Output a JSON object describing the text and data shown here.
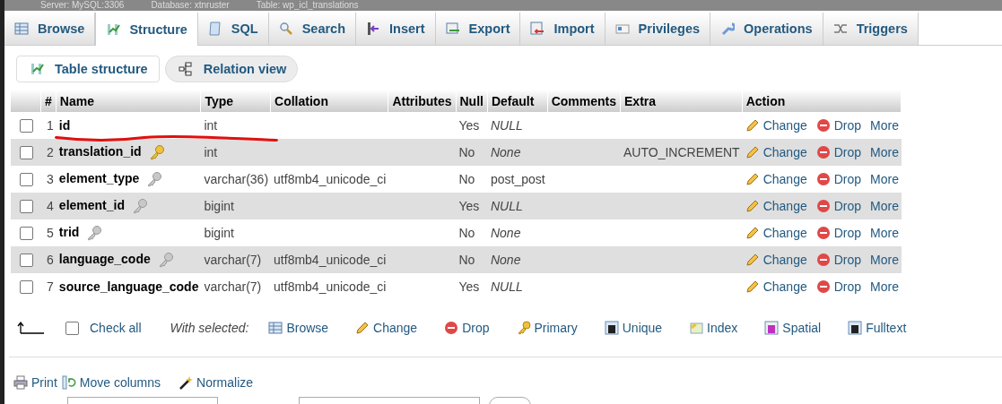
{
  "breadcrumb": [
    "Server: MySQL:3306",
    "Database: xtnruster",
    "Table: wp_icl_translations"
  ],
  "tabs": [
    {
      "label": "Browse",
      "selected": false
    },
    {
      "label": "Structure",
      "selected": true
    },
    {
      "label": "SQL",
      "selected": false
    },
    {
      "label": "Search",
      "selected": false
    },
    {
      "label": "Insert",
      "selected": false
    },
    {
      "label": "Export",
      "selected": false
    },
    {
      "label": "Import",
      "selected": false
    },
    {
      "label": "Privileges",
      "selected": false
    },
    {
      "label": "Operations",
      "selected": false
    },
    {
      "label": "Triggers",
      "selected": false
    }
  ],
  "subtabs": [
    {
      "label": "Table structure",
      "selected": true
    },
    {
      "label": "Relation view",
      "selected": false
    }
  ],
  "table": {
    "columns": [
      "#",
      "Name",
      "Type",
      "Collation",
      "Attributes",
      "Null",
      "Default",
      "Comments",
      "Extra",
      "Action"
    ],
    "rows": [
      {
        "num": "1",
        "name": "id",
        "kind": "plain",
        "type": "int",
        "null": "Yes",
        "default": "NULL",
        "default_italic": true,
        "checked": false,
        "underlined": true,
        "actions": [
          "Change",
          "Drop",
          "More"
        ]
      },
      {
        "num": "2",
        "name": "translation_id",
        "kind": "primary",
        "type": "int",
        "null": "No",
        "default": "None",
        "default_italic": true,
        "extra": "AUTO_INCREMENT",
        "checked": false,
        "underlined": false,
        "actions": [
          "Change",
          "Drop",
          "More"
        ]
      },
      {
        "num": "3",
        "name": "element_type",
        "kind": "indexed",
        "type": "varchar(36)",
        "collation": "utf8mb4_unicode_ci",
        "null": "No",
        "default": "post_post",
        "default_italic": false,
        "checked": false,
        "underlined": false,
        "actions": [
          "Change",
          "Drop",
          "More"
        ]
      },
      {
        "num": "4",
        "name": "element_id",
        "kind": "indexed",
        "type": "bigint",
        "null": "Yes",
        "default": "NULL",
        "default_italic": true,
        "checked": false,
        "underlined": false,
        "actions": [
          "Change",
          "Drop",
          "More"
        ]
      },
      {
        "num": "5",
        "name": "trid",
        "kind": "indexed",
        "type": "bigint",
        "null": "No",
        "default": "None",
        "default_italic": true,
        "checked": false,
        "underlined": false,
        "actions": [
          "Change",
          "Drop",
          "More"
        ]
      },
      {
        "num": "6",
        "name": "language_code",
        "kind": "indexed",
        "type": "varchar(7)",
        "collation": "utf8mb4_unicode_ci",
        "null": "No",
        "default": "None",
        "default_italic": true,
        "checked": false,
        "underlined": false,
        "actions": [
          "Change",
          "Drop",
          "More"
        ]
      },
      {
        "num": "7",
        "name": "source_language_code",
        "kind": "plain",
        "type": "varchar(7)",
        "collation": "utf8mb4_unicode_ci",
        "null": "Yes",
        "default": "NULL",
        "default_italic": true,
        "checked": false,
        "underlined": false,
        "actions": [
          "Change",
          "Drop",
          "More"
        ]
      }
    ]
  },
  "bulk": {
    "check_all": {
      "label": "Check all",
      "checked": false
    },
    "with_selected": "With selected:",
    "actions": [
      "Browse",
      "Change",
      "Drop",
      "Primary",
      "Unique",
      "Index",
      "Spatial",
      "Fulltext"
    ]
  },
  "tools": [
    "Print",
    "Move columns",
    "Normalize"
  ]
}
